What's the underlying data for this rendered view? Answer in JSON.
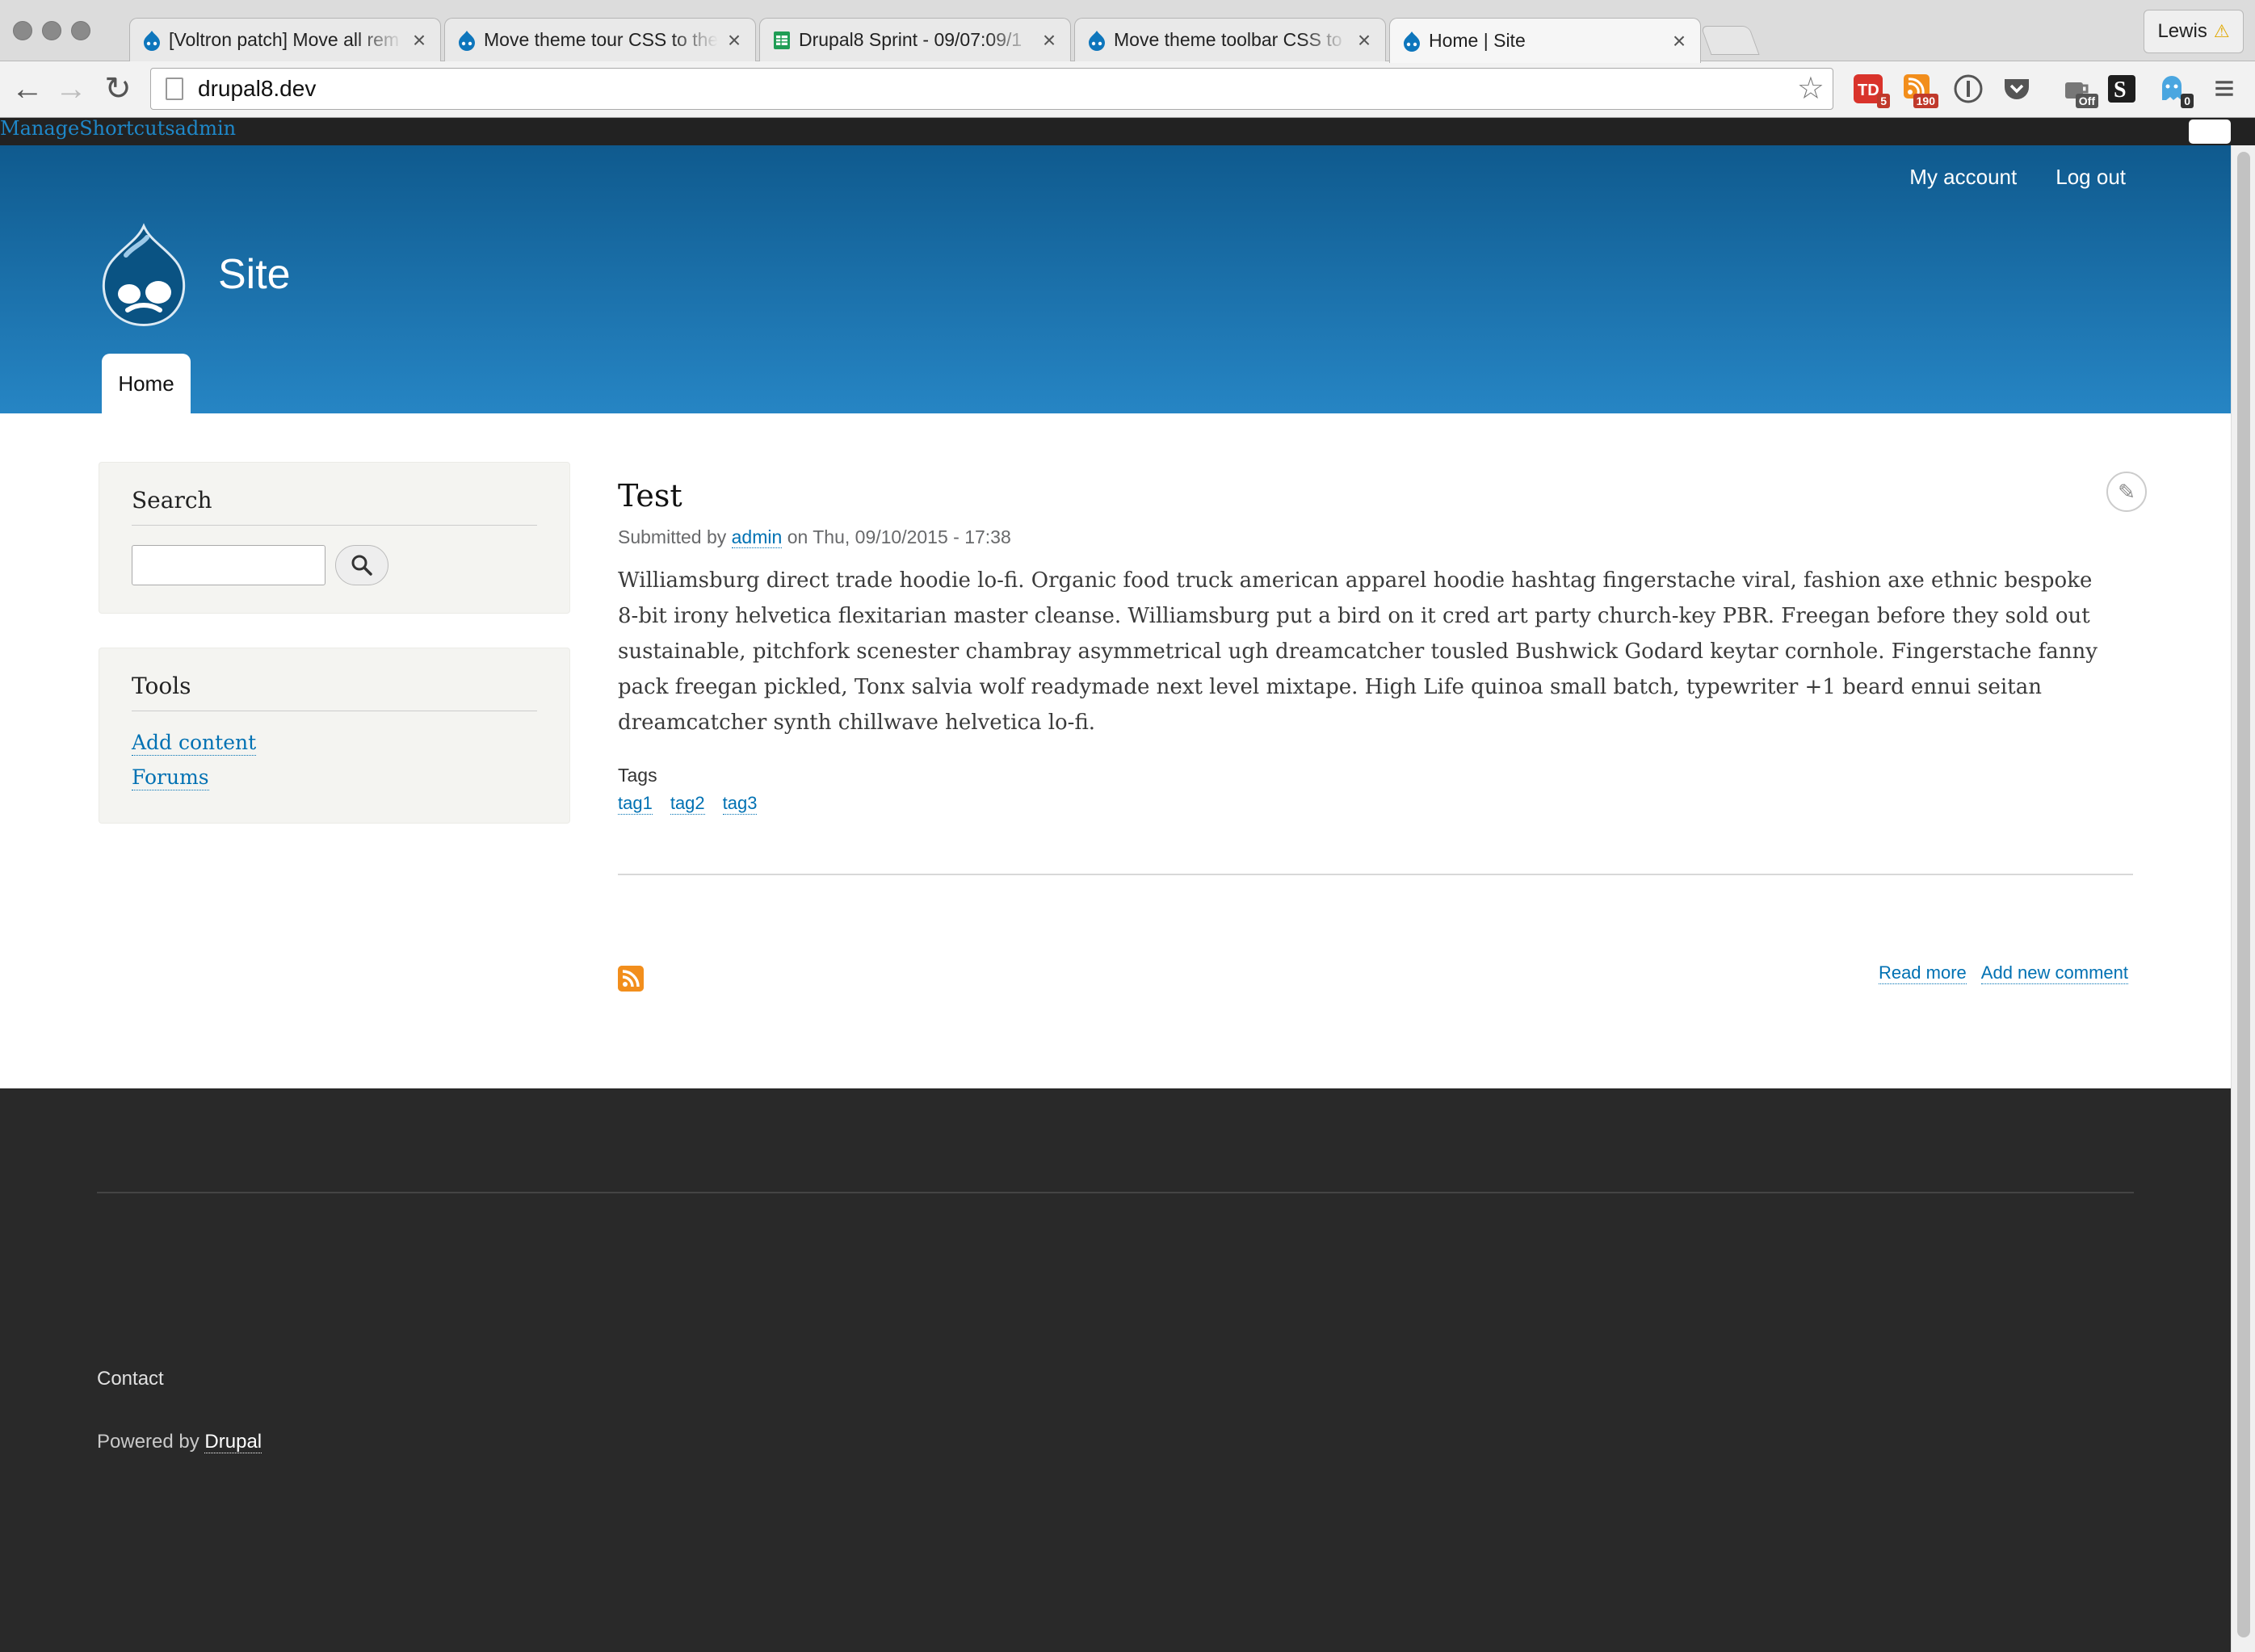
{
  "browser": {
    "tabs": [
      {
        "title": "[Voltron patch] Move all rem",
        "close": "×",
        "icon": "drupal-favicon"
      },
      {
        "title": "Move theme tour CSS to the",
        "close": "×",
        "icon": "drupal-favicon"
      },
      {
        "title": "Drupal8 Sprint - 09/07:09/1",
        "close": "×",
        "icon": "sheets-favicon"
      },
      {
        "title": "Move theme toolbar CSS to",
        "close": "×",
        "icon": "drupal-favicon"
      },
      {
        "title": "Home | Site",
        "close": "×",
        "icon": "drupal-favicon",
        "active": true
      }
    ],
    "profile_name": "Lewis",
    "profile_icon": "⚠",
    "url": "drupal8.dev",
    "back_icon": "←",
    "forward_icon": "→",
    "reload_icon": "↻",
    "star_icon": "☆",
    "menu_icon": "≡",
    "extensions": [
      {
        "name": "todoist",
        "badge": "5"
      },
      {
        "name": "rss",
        "badge": "190"
      },
      {
        "name": "onepassword",
        "badge": ""
      },
      {
        "name": "pocket",
        "badge": ""
      },
      {
        "name": "coffee",
        "badge": "Off"
      },
      {
        "name": "stylish",
        "badge": ""
      },
      {
        "name": "ghostery",
        "badge": "0"
      }
    ]
  },
  "admin_toolbar": {
    "manage": "Manage",
    "shortcuts": "Shortcuts",
    "user": "admin"
  },
  "header": {
    "my_account": "My account",
    "log_out": "Log out",
    "site_name": "Site",
    "main_tab": "Home"
  },
  "sidebar": {
    "search": {
      "title": "Search",
      "input_value": "",
      "button_icon": "search-icon"
    },
    "tools": {
      "title": "Tools",
      "links": [
        "Add content",
        "Forums"
      ]
    }
  },
  "node": {
    "title": "Test",
    "submitted_prefix": "Submitted by",
    "author": "admin",
    "date": "on Thu, 09/10/2015 - 17:38",
    "body": "Williamsburg direct trade hoodie lo-fi. Organic food truck american apparel hoodie hashtag fingerstache viral, fashion axe ethnic bespoke 8-bit irony helvetica flexitarian master cleanse. Williamsburg put a bird on it cred art party church-key PBR. Freegan before they sold out sustainable, pitchfork scenester chambray asymmetrical ugh dreamcatcher tousled Bushwick Godard keytar cornhole. Fingerstache fanny pack freegan pickled, Tonx salvia wolf readymade next level mixtape. High Life quinoa small batch, typewriter +1 beard ennui seitan dreamcatcher synth chillwave helvetica lo-fi.",
    "tags_label": "Tags",
    "tags": [
      "tag1",
      "tag2",
      "tag3"
    ],
    "read_more": "Read more",
    "add_comment": "Add new comment",
    "edit_icon": "✎"
  },
  "footer": {
    "contact": "Contact",
    "powered_prefix": "Powered by",
    "powered_link": "Drupal"
  },
  "colors": {
    "header_top": "#0f5a8e",
    "header_bottom": "#2685c4",
    "link": "#0071b3",
    "footer_bg": "#292929",
    "rss": "#f28e1c"
  }
}
